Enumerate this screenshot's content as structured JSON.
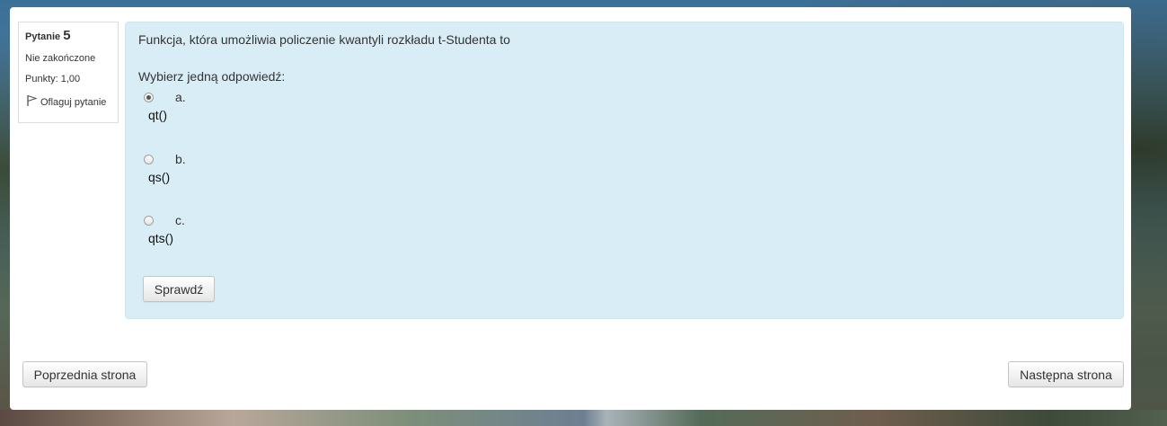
{
  "question_info": {
    "label": "Pytanie",
    "number": "5",
    "state": "Nie zakończone",
    "points": "Punkty: 1,00",
    "flag_label": "Oflaguj pytanie"
  },
  "question": {
    "text": "Funkcja, która umożliwia policzenie kwantyli rozkładu t-Studenta to",
    "prompt": "Wybierz jedną odpowiedź:",
    "answers": [
      {
        "letter": "a.",
        "text": "qt()",
        "selected": true
      },
      {
        "letter": "b.",
        "text": "qs()",
        "selected": false
      },
      {
        "letter": "c.",
        "text": "qts()",
        "selected": false
      }
    ],
    "check_button": "Sprawdź"
  },
  "navigation": {
    "prev_button": "Poprzednia strona",
    "next_button": "Następna strona"
  },
  "colors": {
    "content_bg": "#d9edf7",
    "panel_bg": "#ffffff"
  }
}
